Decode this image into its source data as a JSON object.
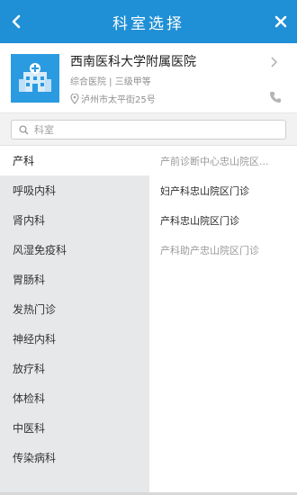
{
  "header": {
    "title": "科室选择",
    "bg_color": "#1f8fd6"
  },
  "hospital": {
    "name": "西南医科大学附属医院",
    "meta": "综合医院 | 三级甲等",
    "address": "泸州市太平街25号",
    "logo_color": "#2a9be0"
  },
  "search": {
    "placeholder": "科室"
  },
  "departments": [
    {
      "label": "产科",
      "active": true
    },
    {
      "label": "呼吸内科",
      "active": false
    },
    {
      "label": "肾内科",
      "active": false
    },
    {
      "label": "风湿免疫科",
      "active": false
    },
    {
      "label": "胃肠科",
      "active": false
    },
    {
      "label": "发热门诊",
      "active": false
    },
    {
      "label": "神经内科",
      "active": false
    },
    {
      "label": "放疗科",
      "active": false
    },
    {
      "label": "体检科",
      "active": false
    },
    {
      "label": "中医科",
      "active": false
    },
    {
      "label": "传染病科",
      "active": false
    }
  ],
  "sub_departments": [
    {
      "label": "产前诊断中心忠山院区...",
      "style": "muted"
    },
    {
      "label": "妇产科忠山院区门诊",
      "style": "dark"
    },
    {
      "label": "产科忠山院区门诊",
      "style": "dark"
    },
    {
      "label": "产科助产忠山院区门诊",
      "style": "muted"
    }
  ]
}
